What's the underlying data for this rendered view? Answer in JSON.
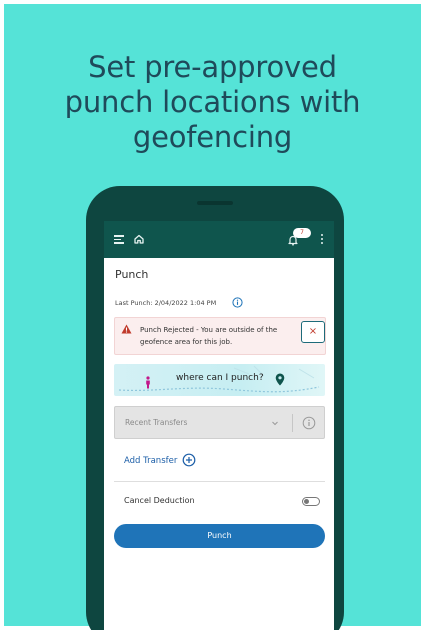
{
  "headline": {
    "line1": "Set pre-approved",
    "line2": "punch locations with",
    "line3": "geofencing"
  },
  "colors": {
    "background": "#55e3d7",
    "headline_text": "#1f4a5a",
    "phone": "#0e4640",
    "app_bar": "#0f554d",
    "primary_button": "#1f74b8",
    "error": "#c0392b"
  },
  "app_bar": {
    "icons": [
      "menu-icon",
      "home-icon",
      "bell-icon",
      "kebab-icon"
    ],
    "notification_count": "7"
  },
  "page": {
    "title": "Punch",
    "last_punch": "Last Punch: 2/04/2022 1:04 PM"
  },
  "alert": {
    "message": "Punch Rejected - You are outside of the geofence area for this job.",
    "close_symbol": "×"
  },
  "map_banner": {
    "text": "where can I punch?"
  },
  "transfers": {
    "placeholder": "Recent Transfers",
    "add_label": "Add Transfer"
  },
  "cancel_deduction": {
    "label": "Cancel Deduction",
    "enabled": false
  },
  "punch_button": {
    "label": "Punch"
  }
}
